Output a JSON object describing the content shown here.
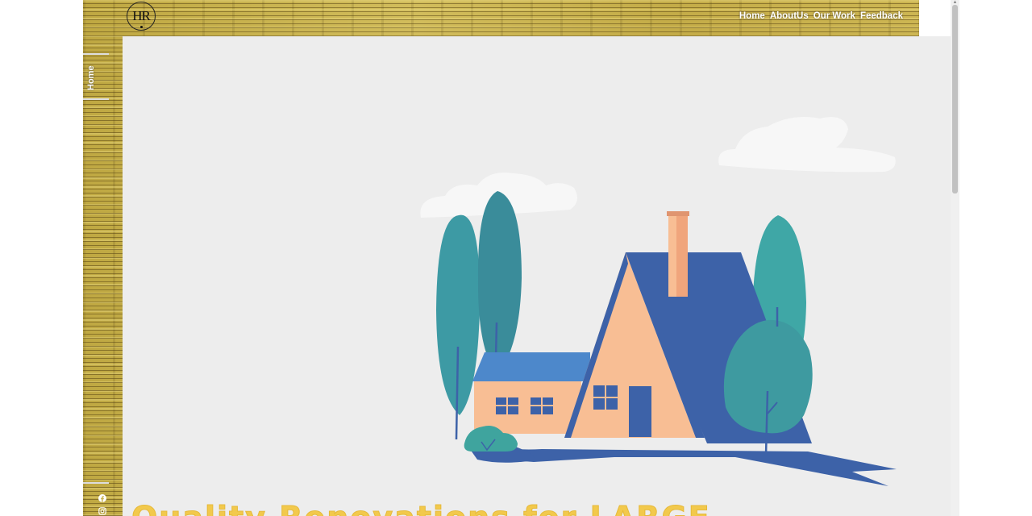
{
  "brand": {
    "logo_text": "HR"
  },
  "nav": {
    "items": [
      {
        "label": "Home"
      },
      {
        "label": "AboutUs"
      },
      {
        "label": "Our Work"
      },
      {
        "label": "Feedback"
      }
    ]
  },
  "sidebar": {
    "current_label": "Home",
    "social_icons": [
      "facebook-icon",
      "instagram-icon"
    ]
  },
  "hero": {
    "heading": "Quality Renovations for LARGE",
    "illustration": "house-illustration"
  },
  "colors": {
    "wood": "#c8b14a",
    "panel": "#ededed",
    "heading": "#f2c94c",
    "roof": "#4169a8",
    "wall": "#f8be94",
    "tree": "#3e9aa0"
  }
}
